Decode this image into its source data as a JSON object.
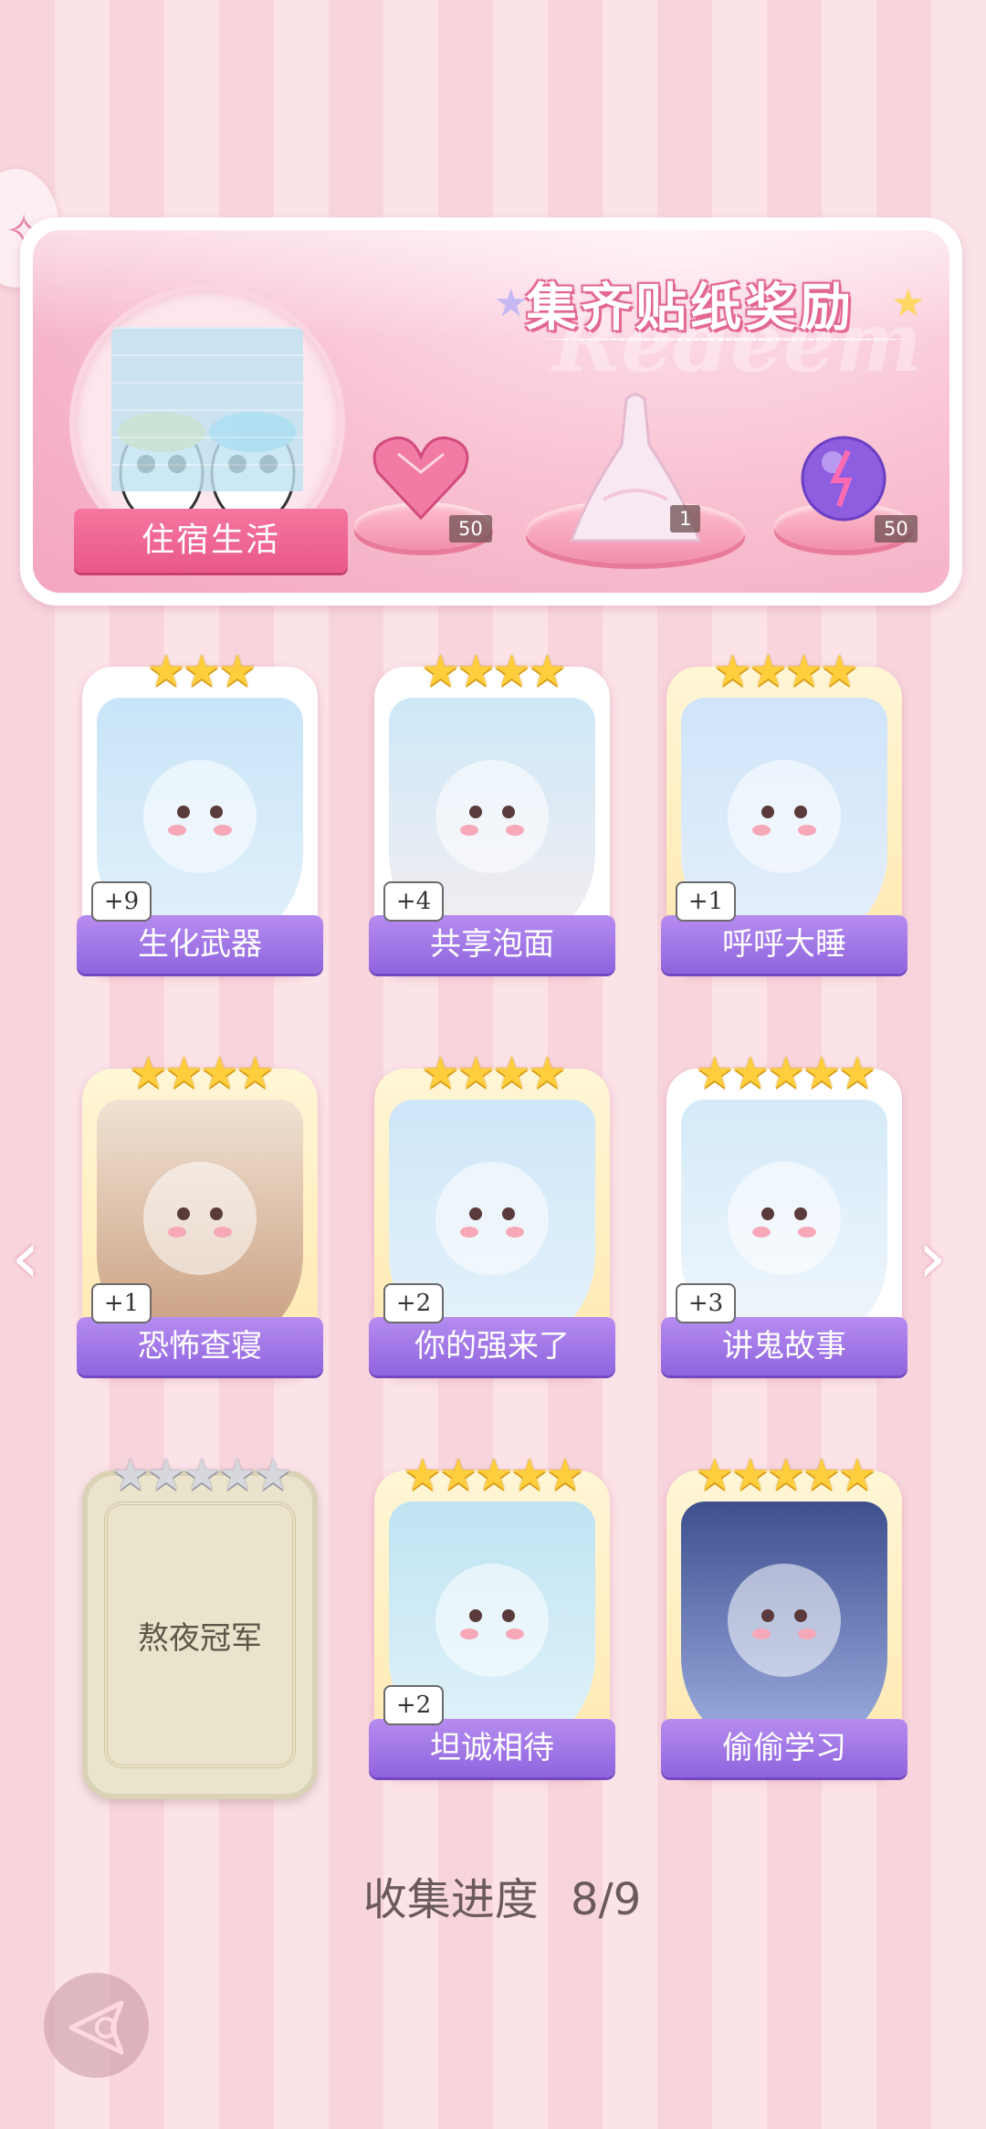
{
  "banner": {
    "title": "集齐贴纸奖励",
    "theme_label": "住宿生活",
    "rewards": [
      {
        "icon": "pink-heart-gem-icon",
        "count": "50"
      },
      {
        "icon": "white-gown-icon",
        "count": "1"
      },
      {
        "icon": "purple-energy-orb-icon",
        "count": "50"
      }
    ]
  },
  "cards": [
    {
      "name": "生化武器",
      "bonus": "+9",
      "stars": 3,
      "frame": "white",
      "art": "capybara-pajamas"
    },
    {
      "name": "共享泡面",
      "bonus": "+4",
      "stars": 4,
      "frame": "white",
      "art": "bunny-noodles"
    },
    {
      "name": "呼呼大睡",
      "bonus": "+1",
      "stars": 4,
      "frame": "gold",
      "art": "sleeping-boy"
    },
    {
      "name": "恐怖查寝",
      "bonus": "+1",
      "stars": 4,
      "frame": "gold",
      "art": "dorm-auntie"
    },
    {
      "name": "你的强来了",
      "bonus": "+2",
      "stars": 4,
      "frame": "gold",
      "art": "cockroach"
    },
    {
      "name": "讲鬼故事",
      "bonus": "+3",
      "stars": 5,
      "frame": "white",
      "art": "ghost-boy"
    },
    {
      "name": "熬夜冠军",
      "bonus": "",
      "stars": 5,
      "frame": "locked",
      "art": "locked"
    },
    {
      "name": "坦诚相待",
      "bonus": "+2",
      "stars": 5,
      "frame": "gold",
      "art": "pandas-shower"
    },
    {
      "name": "偷偷学习",
      "bonus": "",
      "stars": 5,
      "frame": "gold",
      "art": "boy-studying"
    }
  ],
  "progress": {
    "label": "收集进度",
    "value": "8/9"
  },
  "colors": {
    "accent_pink": "#e95887",
    "name_bar_purple": "#8f64de",
    "star_gold": "#ffce3d"
  }
}
